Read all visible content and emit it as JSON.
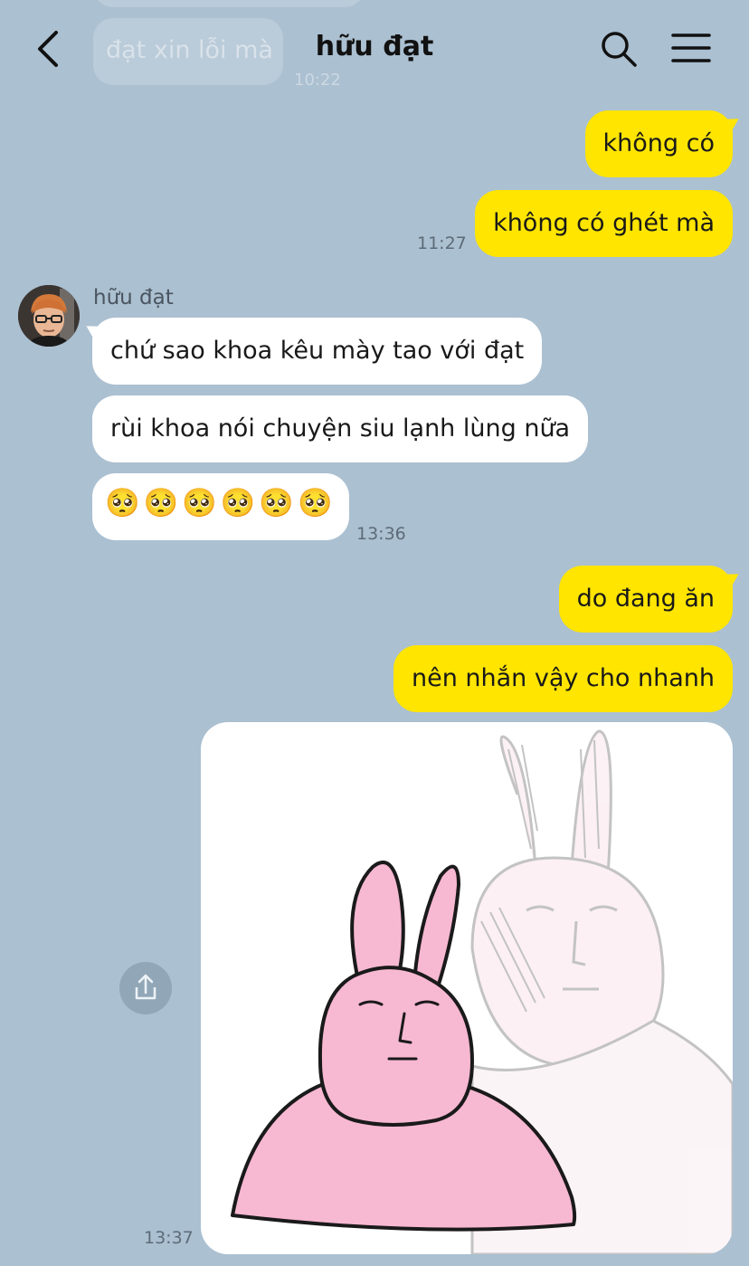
{
  "header": {
    "title": "hữu đạt"
  },
  "faded_previous": {
    "text": "đạt xin lỗi mà",
    "time": "10:22"
  },
  "messages": {
    "m1": "không có",
    "m2": "không có ghét mà",
    "t1": "11:27",
    "sender": "hữu đạt",
    "r1": "chứ sao khoa kêu mày tao với đạt",
    "r2": "rùi khoa nói chuyện siu lạnh lùng nữa",
    "r3": "🥺🥺🥺🥺🥺🥺",
    "t2": "13:36",
    "m3": "do đang ăn",
    "m4": "nên nhắn vậy cho nhanh",
    "t3": "13:37"
  },
  "colors": {
    "background": "#abc0d1",
    "my_bubble": "#ffe500",
    "their_bubble": "#ffffff",
    "sticker_bunny": "#f7b8d2"
  },
  "icons": {
    "back": "chevron-left-icon",
    "search": "search-icon",
    "menu": "hamburger-menu-icon",
    "share": "share-icon"
  }
}
